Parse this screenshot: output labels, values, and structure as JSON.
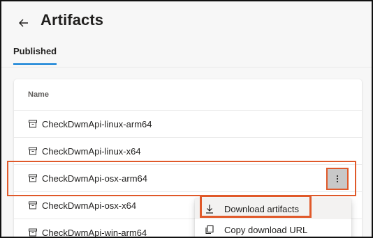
{
  "page": {
    "title": "Artifacts"
  },
  "tabs": [
    {
      "label": "Published"
    }
  ],
  "table": {
    "column_header": "Name",
    "rows": [
      {
        "name": "CheckDwmApi-linux-arm64"
      },
      {
        "name": "CheckDwmApi-linux-x64"
      },
      {
        "name": "CheckDwmApi-osx-arm64"
      },
      {
        "name": "CheckDwmApi-osx-x64"
      },
      {
        "name": "CheckDwmApi-win-arm64"
      }
    ]
  },
  "context_menu": {
    "items": [
      {
        "label": "Download artifacts",
        "icon": "download-icon"
      },
      {
        "label": "Copy download URL",
        "icon": "copy-icon"
      }
    ]
  },
  "colors": {
    "accent": "#0078d4",
    "highlight_outline": "#e0592a"
  }
}
